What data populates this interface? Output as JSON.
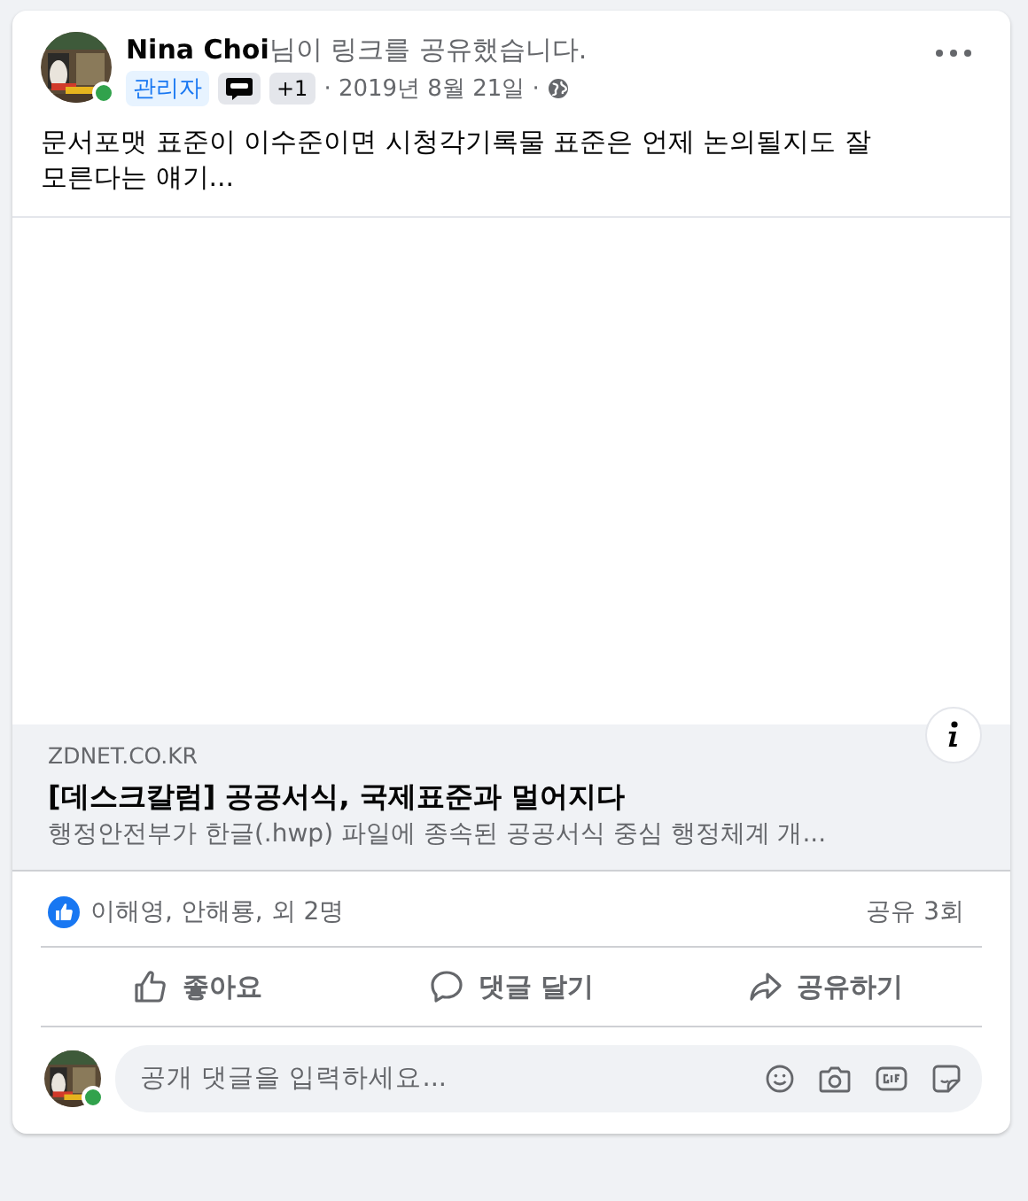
{
  "post": {
    "author": "Nina Choi",
    "action": "님이 링크를 공유했습니다.",
    "badge": "관리자",
    "extra_count": "+1",
    "date": "· 2019년 8월 21일 ·",
    "author_online": true,
    "text": "문서포맷 표준이 이수준이면 시청각기록물 표준은 언제 논의될지도 잘 모른다는 얘기..."
  },
  "link": {
    "domain": "ZDNET.CO.KR",
    "title": "[데스크칼럼] 공공서식, 국제표준과 멀어지다",
    "description": "행정안전부가 한글(.hwp) 파일에 종속된 공공서식 중심 행정체계 개..."
  },
  "reactions": {
    "names": "이해영, 안해룡, 외 2명",
    "shares": "공유 3회"
  },
  "actions": [
    {
      "kind": "like",
      "label": "좋아요"
    },
    {
      "kind": "comment",
      "label": "댓글 달기"
    },
    {
      "kind": "share",
      "label": "공유하기"
    }
  ],
  "comment": {
    "placeholder": "공개 댓글을 입력하세요...",
    "online": true
  }
}
